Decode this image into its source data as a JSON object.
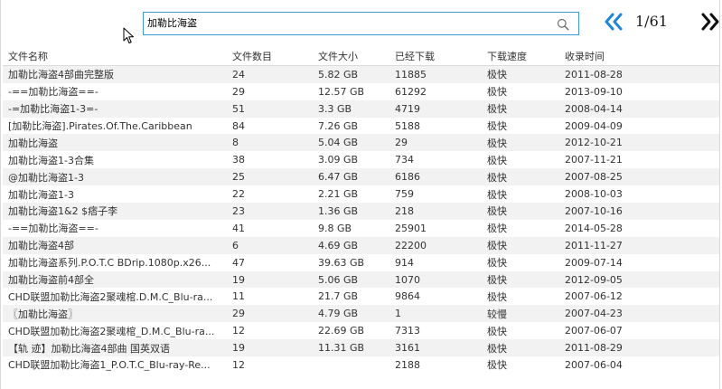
{
  "search": {
    "value": "加勒比海盗"
  },
  "icons": {
    "search": "search-icon",
    "cursor": "mouse-pointer-icon",
    "prev": "double-chevron-left-icon",
    "next": "double-chevron-right-icon"
  },
  "colors": {
    "accent": "#1e87d8",
    "search_border": "#3c9ad8",
    "row_stripe": "#f2f2f2"
  },
  "pager": {
    "text": "1/61"
  },
  "table": {
    "headers": {
      "name": "文件名称",
      "count": "文件数目",
      "size": "文件大小",
      "downloads": "已经下载",
      "speed": "下载速度",
      "date": "收录时间"
    },
    "rows": [
      {
        "name": "加勒比海盗4部曲完整版",
        "count": "24",
        "size": "5.82 GB",
        "downloads": "11885",
        "speed": "极快",
        "date": "2011-08-28"
      },
      {
        "name": "-==加勒比海盗==-",
        "count": "29",
        "size": "12.57 GB",
        "downloads": "61292",
        "speed": "极快",
        "date": "2013-09-10"
      },
      {
        "name": "-=加勒比海盗1-3=-",
        "count": "51",
        "size": "3.3 GB",
        "downloads": "4719",
        "speed": "极快",
        "date": "2008-04-14"
      },
      {
        "name": "[加勒比海盗].Pirates.Of.The.Caribbean",
        "count": "84",
        "size": "7.26 GB",
        "downloads": "5188",
        "speed": "极快",
        "date": "2009-04-09"
      },
      {
        "name": "加勒比海盗",
        "count": "8",
        "size": "5.04 GB",
        "downloads": "29",
        "speed": "极快",
        "date": "2012-10-21"
      },
      {
        "name": "加勒比海盗1-3合集",
        "count": "38",
        "size": "3.09 GB",
        "downloads": "734",
        "speed": "极快",
        "date": "2007-11-21"
      },
      {
        "name": "@加勒比海盗1-3",
        "count": "25",
        "size": "6.47 GB",
        "downloads": "6186",
        "speed": "极快",
        "date": "2007-08-25"
      },
      {
        "name": "加勒比海盗1-3",
        "count": "22",
        "size": "2.21 GB",
        "downloads": "759",
        "speed": "极快",
        "date": "2008-10-03"
      },
      {
        "name": "加勒比海盗1&2 $痞子李",
        "count": "23",
        "size": "1.36 GB",
        "downloads": "218",
        "speed": "极快",
        "date": "2007-10-16"
      },
      {
        "name": "-==加勒比海盗==-",
        "count": "41",
        "size": "9.8 GB",
        "downloads": "25901",
        "speed": "极快",
        "date": "2014-05-28"
      },
      {
        "name": "加勒比海盗4部",
        "count": "6",
        "size": "4.69 GB",
        "downloads": "22200",
        "speed": "极快",
        "date": "2011-11-27"
      },
      {
        "name": "加勒比海盗系列.P.O.T.C BDrip.1080p.x26...",
        "count": "47",
        "size": "39.63 GB",
        "downloads": "914",
        "speed": "极快",
        "date": "2009-07-14"
      },
      {
        "name": "加勒比海盗前4部全",
        "count": "19",
        "size": "5.06 GB",
        "downloads": "1070",
        "speed": "极快",
        "date": "2012-09-05"
      },
      {
        "name": "CHD联盟加勒比海盗2聚魂棺.D.M.C_Blu-ra...",
        "count": "11",
        "size": "21.7 GB",
        "downloads": "9864",
        "speed": "极快",
        "date": "2007-06-12"
      },
      {
        "name": "〖加勒比海盗〗",
        "count": "29",
        "size": "4.79 GB",
        "downloads": "1",
        "speed": "较慢",
        "date": "2007-04-23"
      },
      {
        "name": "CHD联盟加勒比海盗2聚魂棺_D.M.C_Blu-ra...",
        "count": "12",
        "size": "22.69 GB",
        "downloads": "7313",
        "speed": "极快",
        "date": "2007-06-07"
      },
      {
        "name": "【轨 迹】加勒比海盗4部曲 国英双语",
        "count": "19",
        "size": "11.31 GB",
        "downloads": "3161",
        "speed": "极快",
        "date": "2011-08-29"
      },
      {
        "name": "CHD联盟加勒比海盗1_P.O.T.C_Blu-ray-Re...",
        "count": "12",
        "size": "",
        "downloads": "2188",
        "speed": "极快",
        "date": "2007-06-04"
      }
    ]
  }
}
